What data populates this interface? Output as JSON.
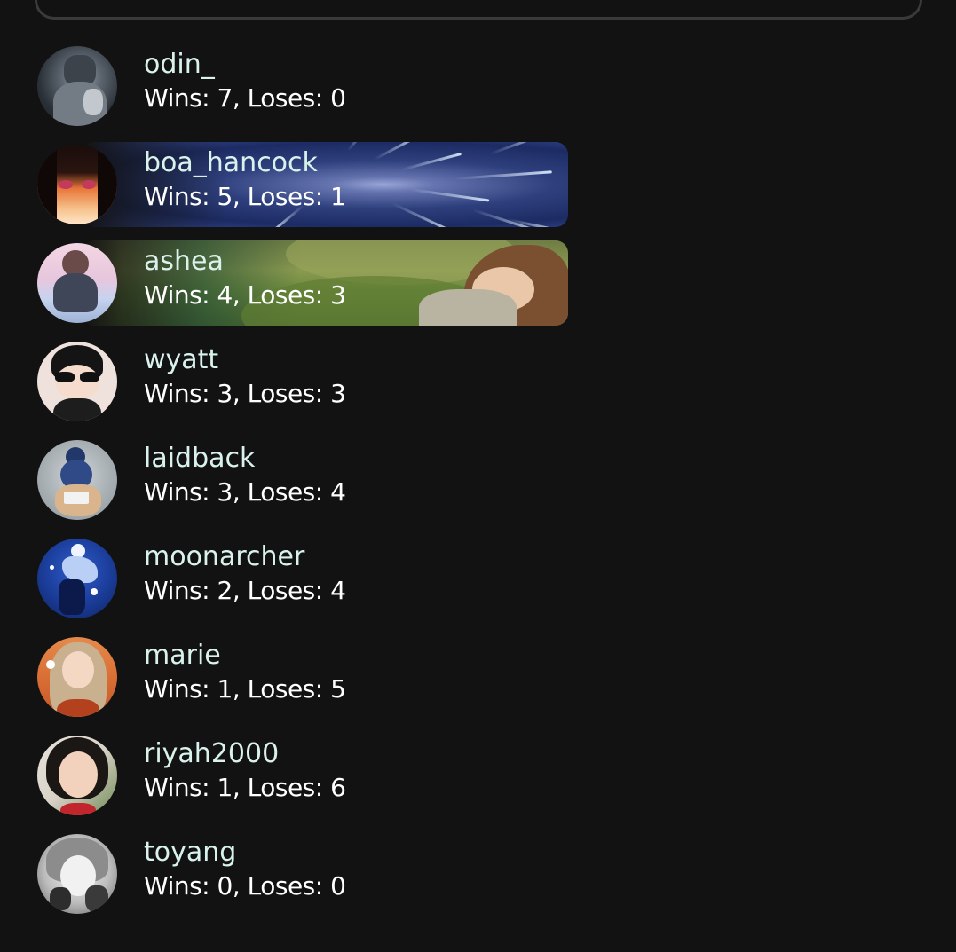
{
  "leaderboard": {
    "players": [
      {
        "username": "odin_",
        "record": "Wins: 7, Loses: 0",
        "avatar": "armored-knight-avatar",
        "banner": "none"
      },
      {
        "username": "boa_hancock",
        "record": "Wins: 5, Loses: 1",
        "avatar": "anime-woman-avatar",
        "banner": "hyperspace-banner"
      },
      {
        "username": "ashea",
        "record": "Wins: 4, Loses: 3",
        "avatar": "sitting-girl-avatar",
        "banner": "meadow-sleeping-girl-banner"
      },
      {
        "username": "wyatt",
        "record": "Wins: 3, Loses: 3",
        "avatar": "chibi-sunglasses-avatar",
        "banner": "none"
      },
      {
        "username": "laidback",
        "record": "Wins: 3, Loses: 4",
        "avatar": "reading-girl-avatar",
        "banner": "none"
      },
      {
        "username": "moonarcher",
        "record": "Wins: 2, Loses: 4",
        "avatar": "night-archer-avatar",
        "banner": "none"
      },
      {
        "username": "marie",
        "record": "Wins: 1, Loses: 5",
        "avatar": "portrait-heart-avatar",
        "banner": "none"
      },
      {
        "username": "riyah2000",
        "record": "Wins: 1, Loses: 6",
        "avatar": "smiling-girl-avatar",
        "banner": "none"
      },
      {
        "username": "toyang",
        "record": "Wins: 0, Loses: 0",
        "avatar": "manga-sketch-avatar",
        "banner": "none"
      }
    ]
  },
  "colors": {
    "background": "#121212",
    "username": "#d9f3ec",
    "record": "#ffffff",
    "search_border": "#3a3a3a"
  }
}
